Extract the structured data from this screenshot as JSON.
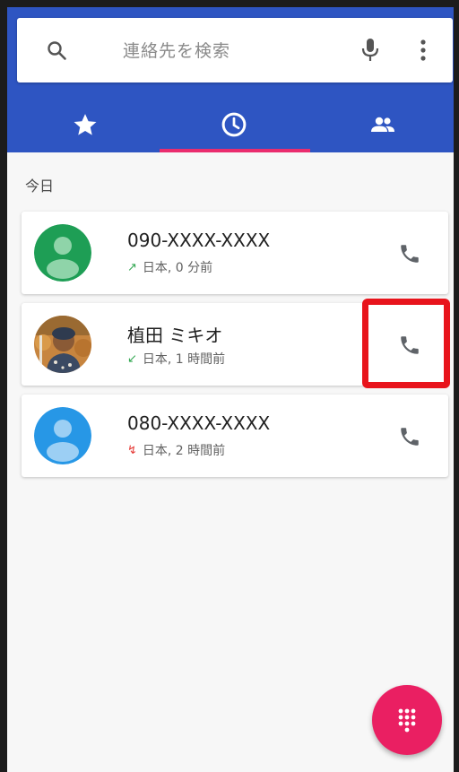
{
  "search": {
    "placeholder": "連絡先を検索"
  },
  "tabs": [
    {
      "name": "favorites",
      "icon": "star-icon"
    },
    {
      "name": "recents",
      "icon": "clock-icon",
      "selected": true
    },
    {
      "name": "contacts",
      "icon": "people-icon"
    }
  ],
  "section": {
    "label": "今日"
  },
  "calls": [
    {
      "name": "090-XXXX-XXXX",
      "direction": "outgoing",
      "arrow": "↗",
      "detail": "日本, 0 分前",
      "avatar": "default-avatar-green",
      "arrow_color": "#34a853"
    },
    {
      "name": "植田 ミキオ",
      "direction": "incoming",
      "arrow": "↙",
      "detail": "日本, 1 時間前",
      "avatar": "photo-avatar",
      "arrow_color": "#34a853"
    },
    {
      "name": "080-XXXX-XXXX",
      "direction": "missed",
      "arrow": "↯",
      "detail": "日本, 2 時間前",
      "avatar": "default-avatar-blue",
      "arrow_color": "#e53935"
    }
  ],
  "colors": {
    "header": "#2e55c2",
    "accent": "#ea2d6e",
    "fab": "#ea1f62",
    "highlight": "#e8141c",
    "avatar_green": "#1e9e55",
    "avatar_blue": "#2797e6"
  }
}
